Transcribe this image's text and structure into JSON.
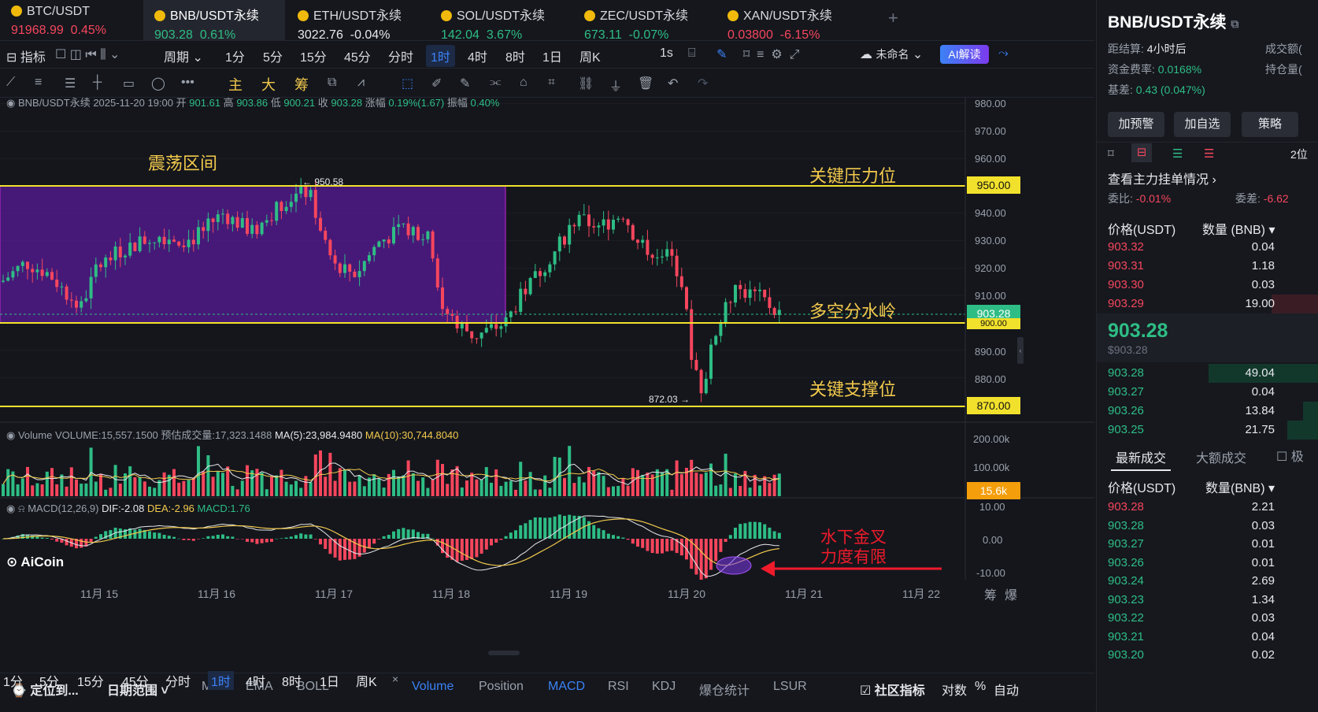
{
  "tabs": [
    {
      "name": "BTC/USDT",
      "price": "91968.99",
      "change": "0.45%",
      "dir": "up"
    },
    {
      "name": "BNB/USDT永续",
      "price": "903.28",
      "change": "0.61%",
      "dir": "up"
    },
    {
      "name": "ETH/USDT永续",
      "price": "3022.76",
      "change": "-0.04%",
      "dir": "flat"
    },
    {
      "name": "SOL/USDT永续",
      "price": "142.04",
      "change": "3.67%",
      "dir": "up"
    },
    {
      "name": "ZEC/USDT永续",
      "price": "673.11",
      "change": "-0.07%",
      "dir": "up"
    },
    {
      "name": "XAN/USDT永续",
      "price": "0.03800",
      "change": "-6.15%",
      "dir": "dn"
    }
  ],
  "add_tab": "+",
  "toolbar": {
    "indicator": "指标",
    "period": "周期",
    "intervals": [
      "1分",
      "5分",
      "15分",
      "45分",
      "分时",
      "1时",
      "4时",
      "8时",
      "1日",
      "周K"
    ],
    "selected": "1时",
    "seconds": "1s",
    "layout_name": "未命名",
    "ai": "AI解读"
  },
  "drawbar": {
    "main": "主",
    "big": "大",
    "chip": "筹"
  },
  "info": {
    "symbol": "BNB/USDT永续",
    "datetime": "2025-11-20 19:00",
    "open_l": "开",
    "open": "901.61",
    "high_l": "高",
    "high": "903.86",
    "low_l": "低",
    "low": "900.21",
    "close_l": "收",
    "close": "903.28",
    "chg_l": "涨幅",
    "chg": "0.19%(1.67)",
    "amp_l": "振幅",
    "amp": "0.40%"
  },
  "price_axis": [
    "980.00",
    "970.00",
    "960.00",
    "940.00",
    "930.00",
    "920.00",
    "910.00",
    "890.00",
    "880.00"
  ],
  "price_tags": {
    "resistance": "950.00",
    "current": "903.28",
    "pivot": "900.00",
    "support": "870.00"
  },
  "annotations": {
    "range": "震荡区间",
    "resistance": "关键压力位",
    "pivot": "多空分水岭",
    "support": "关键支撑位",
    "macd_note_1": "水下金叉",
    "macd_note_2": "力度有限",
    "high_mark": "← 950.58",
    "low_mark": "872.03 →"
  },
  "volume": {
    "label": "Volume",
    "vol": "VOLUME:15,557.1500",
    "est": "预估成交量:17,323.1488",
    "ma5": "MA(5):23,984.9480",
    "ma10": "MA(10):30,744.8040",
    "axis": [
      "200.00k",
      "100.00k"
    ],
    "tag": "15.6k"
  },
  "macd": {
    "label": "MACD(12,26,9)",
    "dif": "DIF:-2.08",
    "dea": "DEA:-2.96",
    "hist": "MACD:1.76",
    "axis": [
      "10.00",
      "0.00",
      "-10.00"
    ]
  },
  "logo": "AiCoin",
  "dates": [
    "11月 15",
    "11月 16",
    "11月 17",
    "11月 18",
    "11月 19",
    "11月 20",
    "11月 21",
    "11月 22"
  ],
  "corner": {
    "a": "筹",
    "b": "爆"
  },
  "bottom": {
    "locate": "定位到...",
    "range": "日期范围",
    "ind": [
      "MA",
      "EMA",
      "BOLL",
      "Volume",
      "Position",
      "MACD",
      "RSI",
      "KDJ",
      "爆仓统计",
      "LSUR"
    ],
    "community": "社区指标",
    "log": "对数",
    "pct": "%",
    "auto": "自动"
  },
  "bottom2": [
    "1分",
    "5分",
    "15分",
    "45分",
    "分时",
    "1时",
    "4时",
    "8时",
    "1日",
    "周K"
  ],
  "right": {
    "title": "BNB/USDT永续",
    "settle_l": "距结算:",
    "settle": "4小时后",
    "volume_l": "成交额(",
    "funding_l": "资金费率:",
    "funding": "0.0168%",
    "oi_l": "持仓量(",
    "basis_l": "基差:",
    "basis": "0.43 (0.047%)",
    "buttons": [
      "加预警",
      "加自选",
      "策略"
    ],
    "depth": "2位",
    "main_orders": "查看主力挂单情况",
    "weibi_l": "委比:",
    "weibi": "-0.01%",
    "weicha_l": "委差:",
    "weicha": "-6.62",
    "hdr_price": "价格(USDT)",
    "hdr_qty": "数量 (BNB)",
    "asks": [
      [
        "903.32",
        "0.04"
      ],
      [
        "903.31",
        "1.18"
      ],
      [
        "903.30",
        "0.03"
      ],
      [
        "903.29",
        "19.00"
      ]
    ],
    "last": "903.28",
    "last_usd": "$903.28",
    "bids": [
      [
        "903.28",
        "49.04"
      ],
      [
        "903.27",
        "0.04"
      ],
      [
        "903.26",
        "13.84"
      ],
      [
        "903.25",
        "21.75"
      ]
    ],
    "trade_tab1": "最新成交",
    "trade_tab2": "大额成交",
    "trade_tab3": "极",
    "t_hdr_price": "价格(USDT)",
    "t_hdr_qty": "数量(BNB)",
    "trades": [
      [
        "903.28",
        "2.21",
        "dn"
      ],
      [
        "903.28",
        "0.03",
        "up"
      ],
      [
        "903.27",
        "0.01",
        "up"
      ],
      [
        "903.26",
        "0.01",
        "up"
      ],
      [
        "903.24",
        "2.69",
        "up"
      ],
      [
        "903.23",
        "1.34",
        "up"
      ],
      [
        "903.22",
        "0.03",
        "up"
      ],
      [
        "903.21",
        "0.04",
        "up"
      ],
      [
        "903.20",
        "0.02",
        "up"
      ]
    ]
  }
}
